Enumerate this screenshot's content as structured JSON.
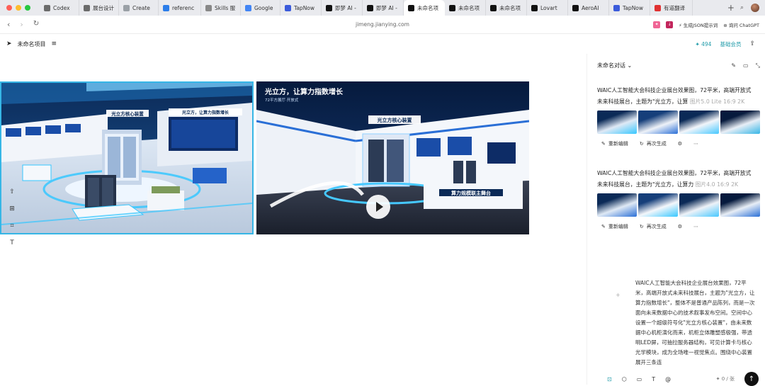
{
  "tabs": [
    {
      "label": "Codex",
      "icon": "codex-icon",
      "color": "#6b6b6b"
    },
    {
      "label": "展台设计",
      "icon": "globe-icon",
      "color": "#6b6b6b"
    },
    {
      "label": "Create",
      "icon": "create-icon",
      "color": "#9aa0a6"
    },
    {
      "label": "referenc",
      "icon": "reference-icon",
      "color": "#2b7de9"
    },
    {
      "label": "Skills 服",
      "icon": "skills-icon",
      "color": "#888888"
    },
    {
      "label": "Google",
      "icon": "google-icon",
      "color": "#4285f4"
    },
    {
      "label": "TapNow",
      "icon": "tapnow-icon",
      "color": "#3b5bdb"
    },
    {
      "label": "即梦 AI -",
      "icon": "jimeng-icon",
      "color": "#111111"
    },
    {
      "label": "即梦 AI -",
      "icon": "jimeng-icon",
      "color": "#111111"
    },
    {
      "label": "未命名项",
      "icon": "jimeng-icon",
      "color": "#111111",
      "active": true
    },
    {
      "label": "未命名项",
      "icon": "jimeng-icon",
      "color": "#111111"
    },
    {
      "label": "未命名项",
      "icon": "jimeng-icon",
      "color": "#111111"
    },
    {
      "label": "Lovart",
      "icon": "lovart-icon",
      "color": "#111111"
    },
    {
      "label": "AeroAI",
      "icon": "aeroai-icon",
      "color": "#111111"
    },
    {
      "label": "TapNow",
      "icon": "tapnow-icon",
      "color": "#3b5bdb"
    },
    {
      "label": "有道翻译",
      "icon": "youdao-icon",
      "color": "#e03131"
    }
  ],
  "address": {
    "url": "jimeng.jianying.com",
    "ext_json": "生成JSON提示词",
    "ext_chatgpt": "询问 ChatGPT"
  },
  "project": {
    "name": "未命名项目",
    "credits": "494",
    "member": "基础会员"
  },
  "canvas": {
    "image_b_title": "光立方，让算力指数增长",
    "image_b_subtitle": "72平方展厅·开放式",
    "image_b_sign": "算力规模联主舞台",
    "image_b_core": "光立方核心装置",
    "image_a_core": "光立方核心装置",
    "image_a_title": "光立方，让算力指数增长"
  },
  "panel": {
    "conversation": "未命名对话",
    "results": [
      {
        "title_line1": "WAIC人工智能大会科技企业展台效果图，72平米，高端开放式",
        "title_line2": "未来科技展台，主题为\"光立方，让算",
        "meta": "图片5.0 Lite  16:9  2K",
        "edit": "重新编辑",
        "regen": "再次生成"
      },
      {
        "title_line1": "WAIC人工智能大会科技企业展台效果图，72平米，高端开放式",
        "title_line2": "未来科技展台，主题为\"光立方，让算力",
        "meta": "图片4.0  16:9  2K",
        "edit": "重新编辑",
        "regen": "再次生成"
      }
    ],
    "prompt_text": "WAIC人工智能大会科技企业展台效果图，72平米，高端开放式未来科技展台，主题为\"光立方，让算力指数增长\"，整体不是普通产品陈列，而是一次面向未来数据中心的技术叙事发布空间。空间中心设置一个超级符号化\"光立方核心装置\"，由未来数据中心机柜演化而来，机柜立体雕塑感极强，带透明LED屏，可抽拉服务器结构，可见计算卡与核心光学模块，成为全场唯一视觉焦点。围绕中心装置展开三条连",
    "counter": "0 / 张"
  }
}
